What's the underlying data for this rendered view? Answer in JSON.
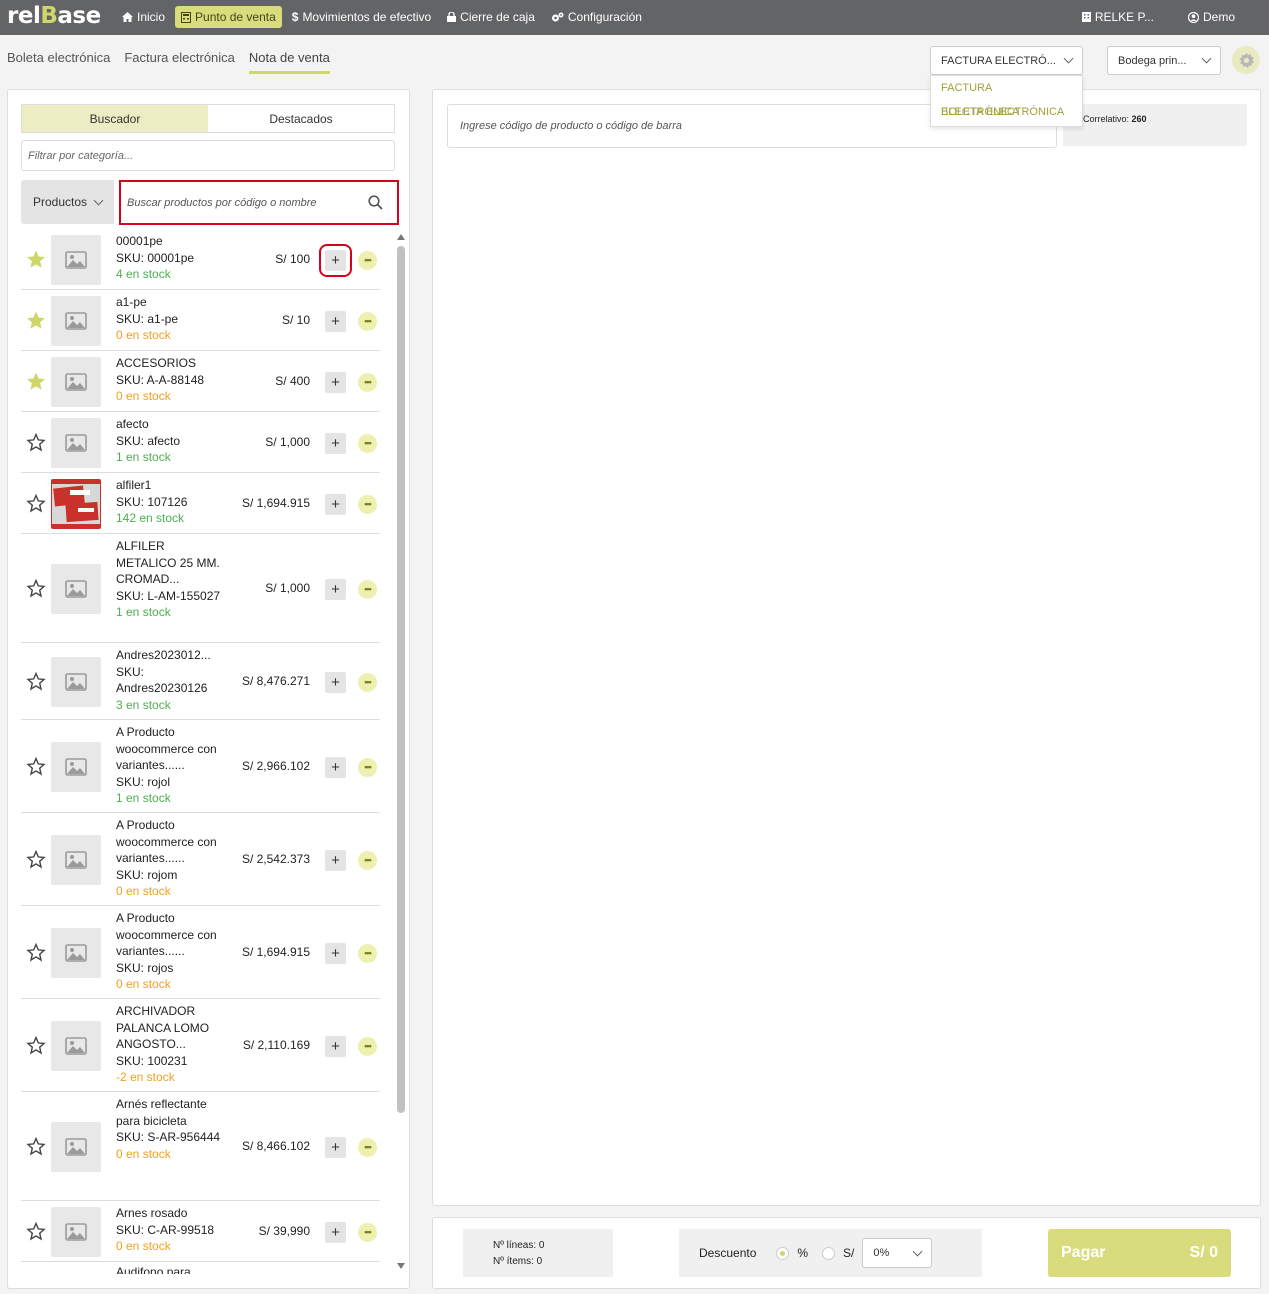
{
  "brand": {
    "logo_left": "rel",
    "logo_mid": "B",
    "logo_right": "ase"
  },
  "nav": {
    "home": "Inicio",
    "pos": "Punto de venta",
    "cash": "Movimientos de efectivo",
    "close": "Cierre de caja",
    "config": "Configuración",
    "company": "RELKE P...",
    "user": "Demo"
  },
  "doc_tabs": [
    "Boleta electrónica",
    "Factura electrónica",
    "Nota de venta"
  ],
  "doc_type_select": {
    "value": "FACTURA ELECTRÓ...",
    "options": [
      "FACTURA ELECTRÓNICA",
      "BOLETA ELECTRÓNICA"
    ]
  },
  "warehouse_select": {
    "value": "Bodega prin..."
  },
  "left": {
    "tab_search": "Buscador",
    "tab_featured": "Destacados",
    "category_placeholder": "Filtrar por categoría...",
    "product_select": "Productos",
    "search_placeholder": "Buscar productos por código o nombre"
  },
  "products": [
    {
      "name": "00001pe",
      "sku": "SKU: 00001pe",
      "stock": "4 en stock",
      "price": "S/ 100",
      "fav": true
    },
    {
      "name": "a1-pe",
      "sku": "SKU: a1-pe",
      "stock": "0 en stock",
      "price": "S/ 10",
      "fav": true
    },
    {
      "name": "ACCESORIOS",
      "sku": "SKU: A-A-88148",
      "stock": "0 en stock",
      "price": "S/ 400",
      "fav": true
    },
    {
      "name": "afecto",
      "sku": "SKU: afecto",
      "stock": "1 en stock",
      "price": "S/ 1,000",
      "fav": false
    },
    {
      "name": "alfiler1",
      "sku": "SKU: 107126",
      "stock": "142 en stock",
      "price": "S/ 1,694.915",
      "fav": false
    },
    {
      "name": "ALFILER METALICO 25 MM. CROMAD...",
      "sku": "SKU: L-AM-155027",
      "stock": "1 en stock",
      "price": "S/ 1,000",
      "fav": false
    },
    {
      "name": "Andres2023012...",
      "sku": "SKU: Andres20230126",
      "stock": "3 en stock",
      "price": "S/ 8,476.271",
      "fav": false
    },
    {
      "name": "A Producto woocommerce con variantes......",
      "sku": "SKU: rojol",
      "stock": "1 en stock",
      "price": "S/ 2,966.102",
      "fav": false
    },
    {
      "name": "A Producto woocommerce con variantes......",
      "sku": "SKU: rojom",
      "stock": "0 en stock",
      "price": "S/ 2,542.373",
      "fav": false
    },
    {
      "name": "A Producto woocommerce con variantes......",
      "sku": "SKU: rojos",
      "stock": "0 en stock",
      "price": "S/ 1,694.915",
      "fav": false
    },
    {
      "name": "ARCHIVADOR PALANCA LOMO ANGOSTO...",
      "sku": "SKU: 100231",
      "stock": "-2 en stock",
      "price": "S/ 2,110.169",
      "fav": false
    },
    {
      "name": "Arnés reflectante para bicicleta",
      "sku": "SKU: S-AR-956444",
      "stock": "0 en stock",
      "price": "S/ 8,466.102",
      "fav": false
    },
    {
      "name": "Arnes rosado",
      "sku": "SKU: C-AR-99518",
      "stock": "0 en stock",
      "price": "S/ 39,990",
      "fav": false
    },
    {
      "name": "Audifono para...",
      "sku": "",
      "stock": "",
      "price": "",
      "fav": false
    }
  ],
  "right": {
    "code_placeholder": "Ingrese código de producto o código de barra",
    "correlative_label": "Correlativo:",
    "correlative_value": "260"
  },
  "summary": {
    "lines": "Nº líneas: 0",
    "items": "Nº ítems: 0",
    "discount_label": "Descuento",
    "pct": "%",
    "soles": "S/",
    "discount_value": "0%",
    "pay_label": "Pagar",
    "pay_total": "S/ 0"
  },
  "colors": {
    "accent": "#d8dc7c",
    "topbar": "#636466",
    "highlight": "#d9001b",
    "stock_ok": "#4caf50",
    "stock_zero": "#f0a020"
  }
}
